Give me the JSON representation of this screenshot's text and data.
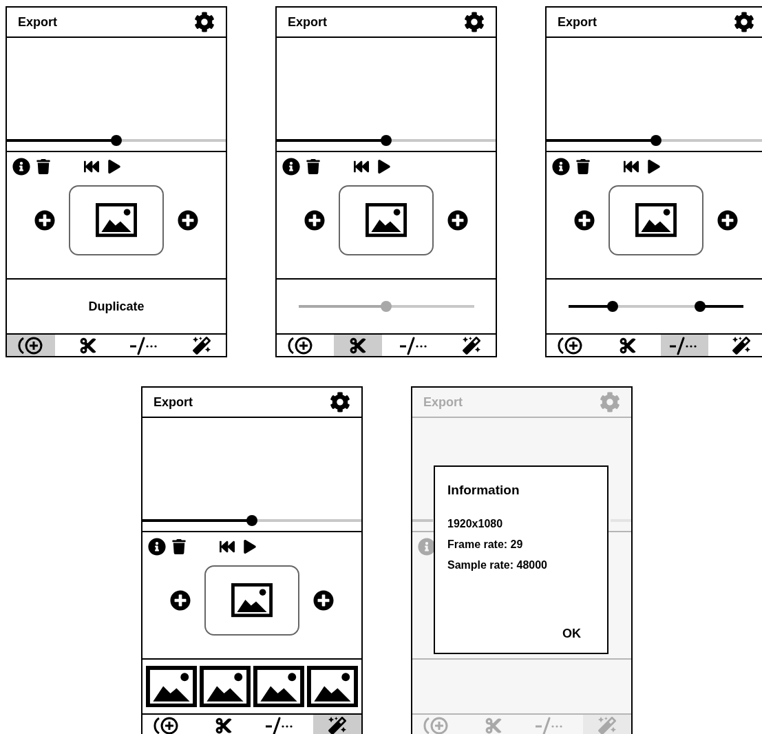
{
  "screens": [
    {
      "title": "Export",
      "dimmed": false,
      "timeline": {
        "level": 0.5
      },
      "panel": {
        "kind": "duplicate",
        "label": "Duplicate"
      },
      "tabs": [
        {
          "selected": true
        },
        {
          "selected": false
        },
        {
          "selected": false
        },
        {
          "selected": false
        }
      ]
    },
    {
      "title": "Export",
      "dimmed": false,
      "timeline": {
        "level": 0.5
      },
      "panel": {
        "kind": "slider",
        "level": 0.5
      },
      "tabs": [
        {
          "selected": false
        },
        {
          "selected": true
        },
        {
          "selected": false
        },
        {
          "selected": false
        }
      ]
    },
    {
      "title": "Export",
      "dimmed": false,
      "timeline": {
        "level": 0.5
      },
      "panel": {
        "kind": "range",
        "handles": [
          {
            "level": 0.25
          },
          {
            "level": 0.75
          }
        ]
      },
      "tabs": [
        {
          "selected": false
        },
        {
          "selected": false
        },
        {
          "selected": true
        },
        {
          "selected": false
        }
      ]
    },
    {
      "title": "Export",
      "dimmed": false,
      "timeline": {
        "level": 0.5
      },
      "panel": {
        "kind": "thumbnails"
      },
      "tabs": [
        {
          "selected": false
        },
        {
          "selected": false
        },
        {
          "selected": false
        },
        {
          "selected": true
        }
      ]
    },
    {
      "title": "Export",
      "dimmed": true,
      "panel": {
        "kind": "empty"
      },
      "tabs": [
        {
          "selected": false
        },
        {
          "selected": false
        },
        {
          "selected": false
        },
        {
          "selected": true
        }
      ],
      "dialog": {
        "title": "Information",
        "lines": [
          "1920x1080",
          "Frame rate: 29",
          "Sample rate: 48000"
        ],
        "button": "OK"
      }
    }
  ]
}
